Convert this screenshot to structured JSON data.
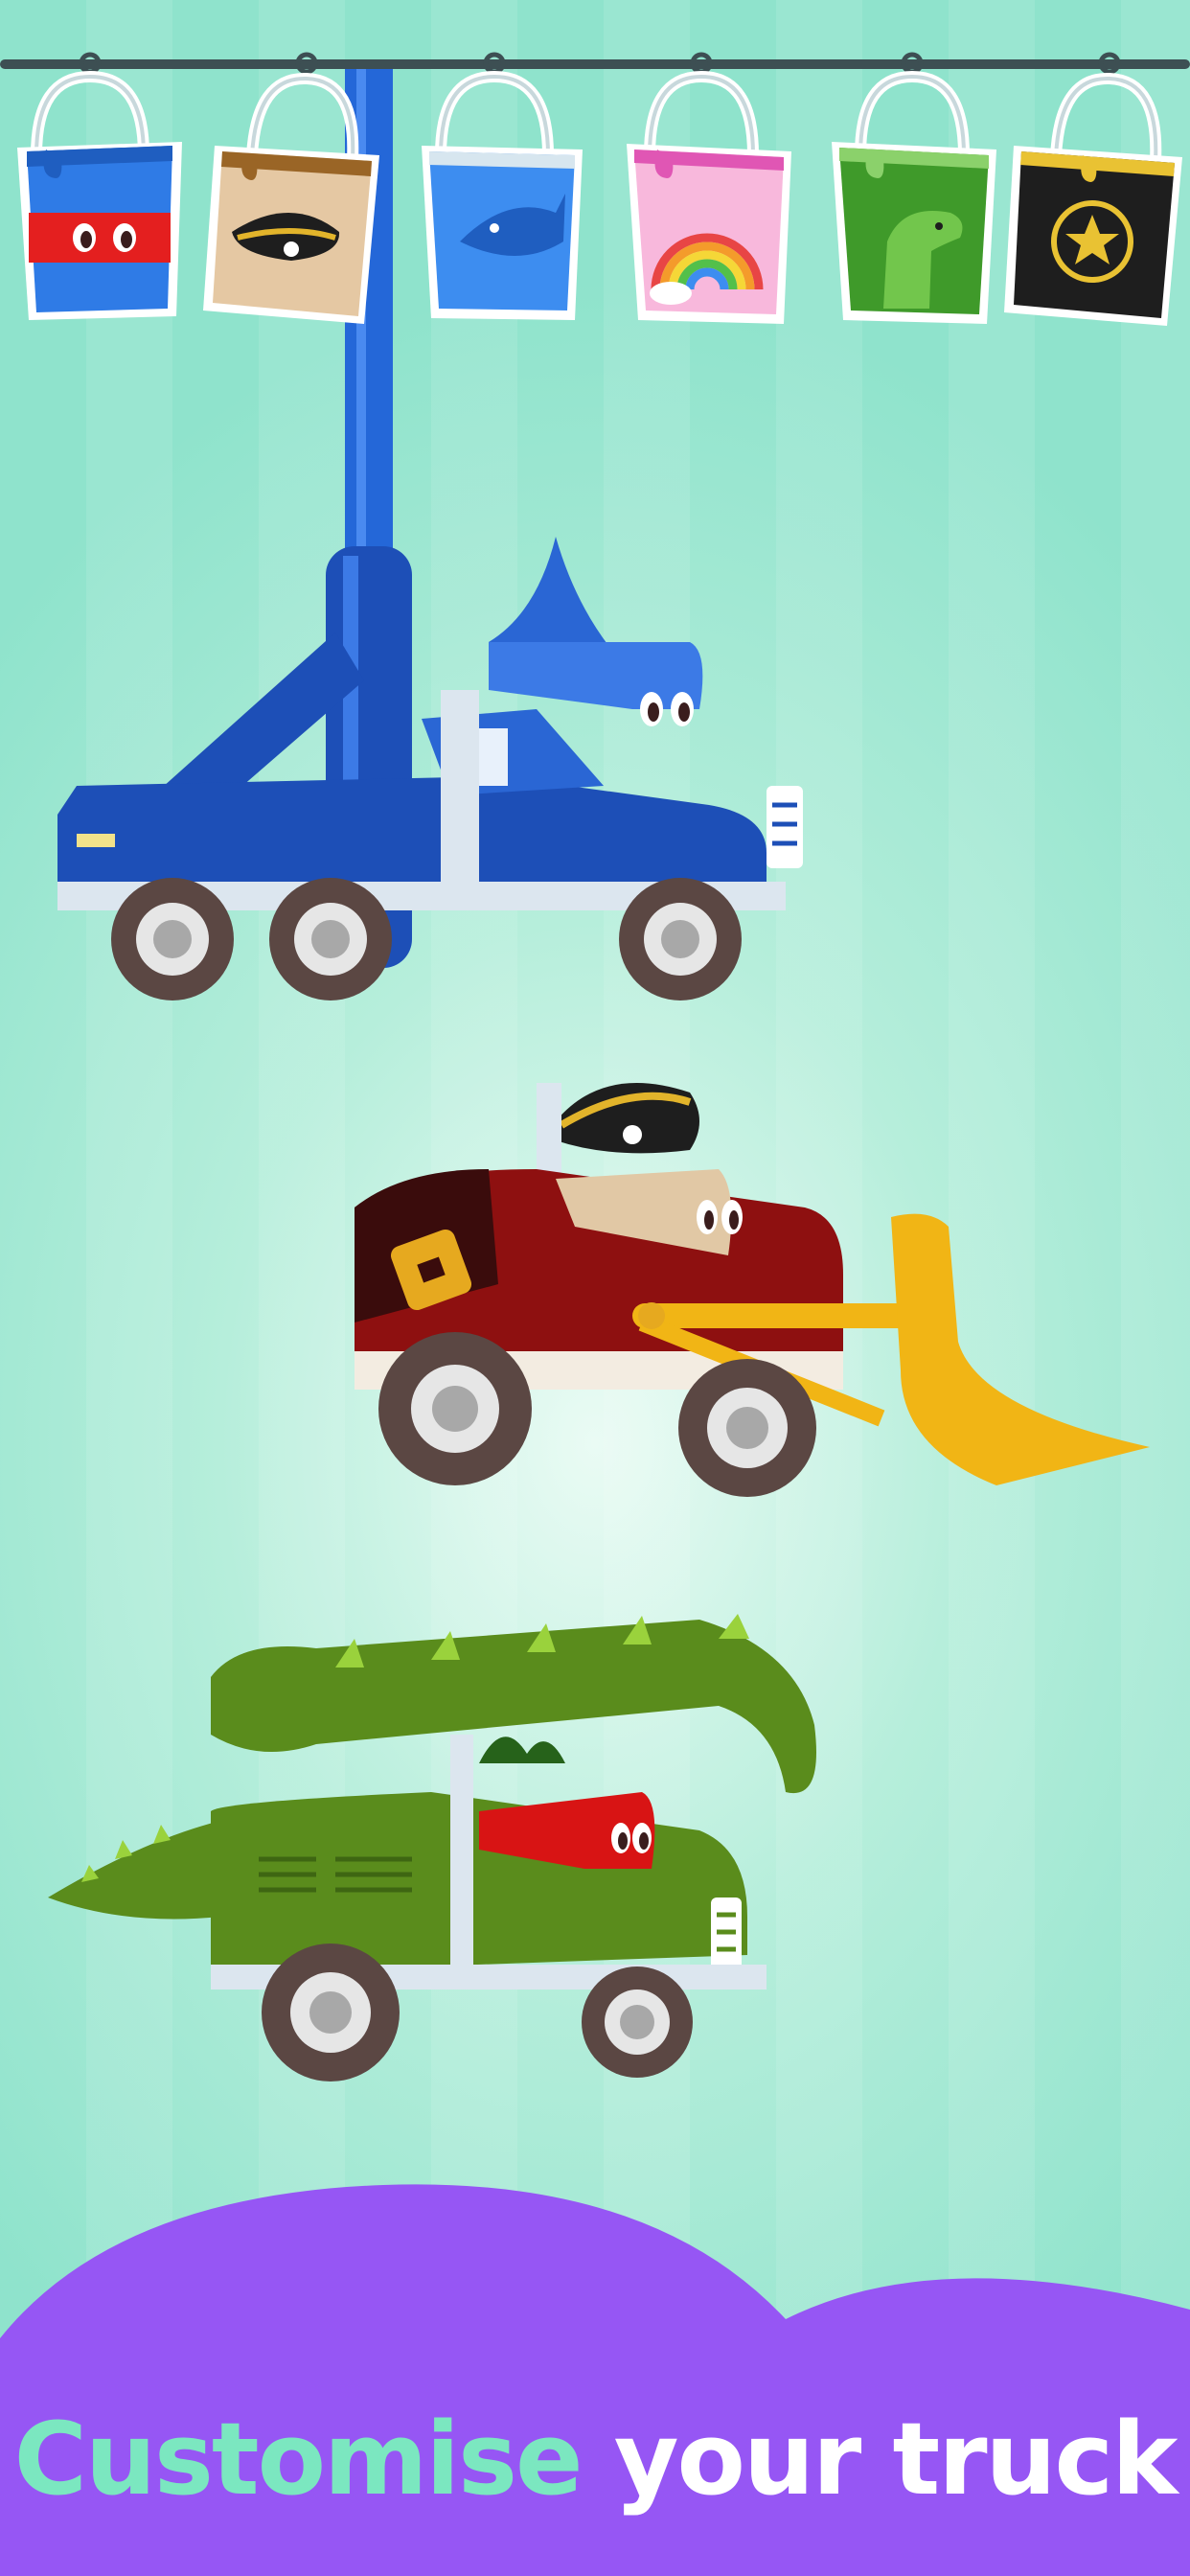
{
  "paint_buckets": [
    {
      "name": "red-face",
      "color": "#2f7be6"
    },
    {
      "name": "pirate",
      "color": "#e5c8a3"
    },
    {
      "name": "shark",
      "color": "#3d8df0"
    },
    {
      "name": "rainbow",
      "color": "#f8b8dc"
    },
    {
      "name": "dinosaur",
      "color": "#3f9a2a"
    },
    {
      "name": "sheriff",
      "color": "#1e1e1e"
    }
  ],
  "trucks": [
    {
      "name": "shark-crane-truck",
      "color": "#1d4fb7"
    },
    {
      "name": "pirate-bulldozer",
      "color": "#8e1010"
    },
    {
      "name": "dinosaur-digger",
      "color": "#5a8c1c"
    }
  ],
  "caption": {
    "accent": "Customise",
    "rest": "your truck"
  },
  "colors": {
    "background": "#9fe8d2",
    "banner": "#9656f4",
    "accent_text": "#7be7c0"
  }
}
